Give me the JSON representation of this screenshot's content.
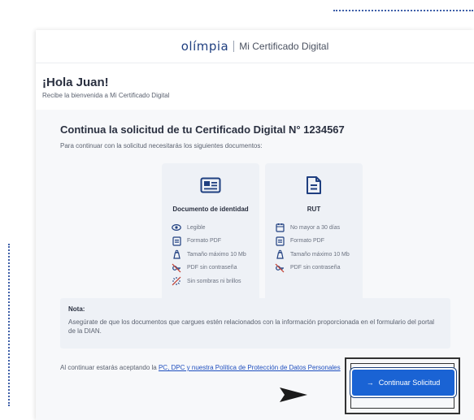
{
  "header": {
    "logo_text": "olímpia",
    "product_name": "Mi Certificado Digital"
  },
  "greeting": {
    "title": "¡Hola Juan!",
    "subtitle": "Recibe la bienvenida a Mi Certificado Digital"
  },
  "request": {
    "title": "Continua la solicitud de tu Certificado Digital N° 1234567",
    "subtitle": "Para continuar con la solicitud necesitarás los siguientes documentos:"
  },
  "documents": [
    {
      "title": "Documento de identidad",
      "icon": "id-card-icon",
      "requirements": [
        {
          "icon": "eye-icon",
          "label": "Legible"
        },
        {
          "icon": "pdf-file-icon",
          "label": "Formato PDF"
        },
        {
          "icon": "weight-icon",
          "label": "Tamaño máximo 10 Mb"
        },
        {
          "icon": "no-key-icon",
          "label": "PDF sin contraseña"
        },
        {
          "icon": "no-glare-icon",
          "label": "Sin sombras ni brillos"
        }
      ]
    },
    {
      "title": "RUT",
      "icon": "document-icon",
      "requirements": [
        {
          "icon": "calendar-icon",
          "label": "No mayor a 30 días"
        },
        {
          "icon": "pdf-file-icon",
          "label": "Formato PDF"
        },
        {
          "icon": "weight-icon",
          "label": "Tamaño máximo 10 Mb"
        },
        {
          "icon": "no-key-icon",
          "label": "PDF sin contraseña"
        }
      ]
    }
  ],
  "note": {
    "title": "Nota:",
    "text": "Asegúrate de que los documentos que cargues estén relacionados con la información proporcionada en el formulario del portal de la DIAN."
  },
  "terms": {
    "prefix": "Al continuar estarás aceptando la ",
    "link_text": "PC, DPC y nuestra Política de Protección de Datos Personales"
  },
  "cta": {
    "label": "Continuar Solicitud",
    "arrow": "→"
  },
  "colors": {
    "accent": "#1a63d4",
    "brand": "#1f3f80",
    "panel": "#f7f8fa",
    "card": "#eef1f6"
  }
}
